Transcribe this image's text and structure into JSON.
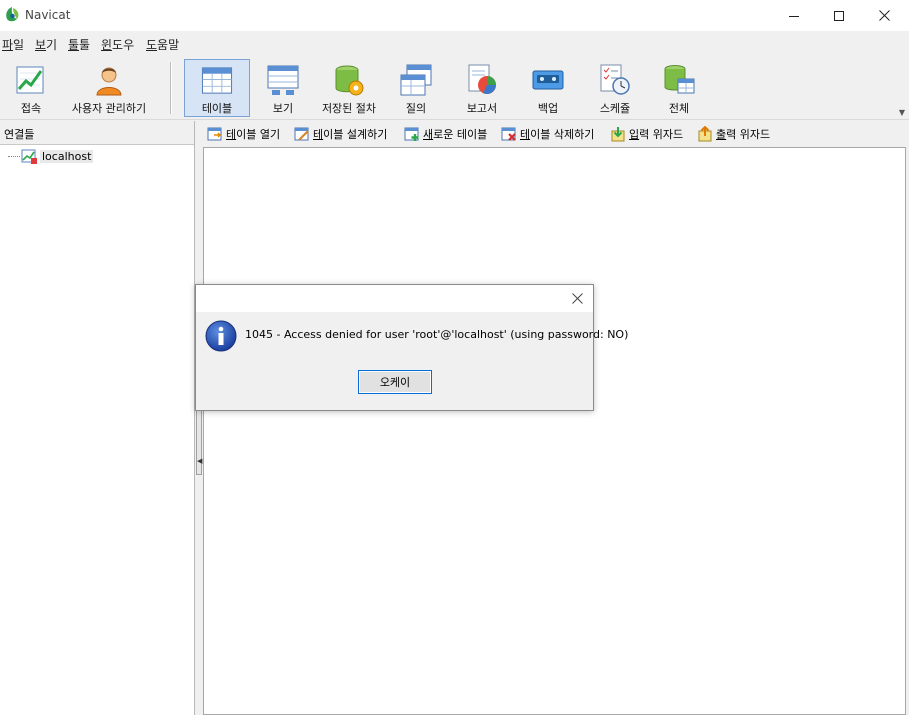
{
  "window": {
    "title": "Navicat"
  },
  "menu": [
    {
      "label": "파일",
      "accel": "파"
    },
    {
      "label": "보기",
      "accel": "보"
    },
    {
      "label": "툴툴",
      "accel": "툴"
    },
    {
      "label": "윈도우",
      "accel": "윈"
    },
    {
      "label": "도움말",
      "accel": "도"
    }
  ],
  "toolbar": {
    "items": [
      {
        "label": "접속",
        "icon": "connect-icon"
      },
      {
        "label": "사용자 관리하기",
        "icon": "user-icon"
      },
      {
        "label": "테이블",
        "icon": "table-icon",
        "active": true
      },
      {
        "label": "보기",
        "icon": "view-icon"
      },
      {
        "label": "저장된 절차",
        "icon": "procedure-icon"
      },
      {
        "label": "질의",
        "icon": "query-icon"
      },
      {
        "label": "보고서",
        "icon": "report-icon"
      },
      {
        "label": "백업",
        "icon": "backup-icon"
      },
      {
        "label": "스케쥴",
        "icon": "schedule-icon"
      },
      {
        "label": "전체",
        "icon": "all-icon"
      }
    ]
  },
  "connections": {
    "header": "연결들",
    "items": [
      {
        "label": "localhost",
        "icon": "server-icon"
      }
    ]
  },
  "table_toolbar": {
    "items": [
      {
        "label": "테이블 열기",
        "accel": "테",
        "icon": "open-table-icon"
      },
      {
        "label": "테이블 설계하기",
        "accel": "테",
        "icon": "design-table-icon"
      },
      {
        "label": "새로운 테이블",
        "accel": "새",
        "icon": "new-table-icon"
      },
      {
        "label": "테이블 삭제하기",
        "accel": "테",
        "icon": "delete-table-icon"
      },
      {
        "label": "입력 위자드",
        "accel": "입",
        "icon": "import-wizard-icon"
      },
      {
        "label": "출력 위자드",
        "accel": "출",
        "icon": "export-wizard-icon"
      }
    ]
  },
  "dialog": {
    "message": "1045 - Access denied for user 'root'@'localhost' (using password: NO)",
    "ok_label": "오케이",
    "icon": "info-icon"
  },
  "colors": {
    "accent": "#0a6cd6",
    "selection": "#d6e4f5"
  }
}
